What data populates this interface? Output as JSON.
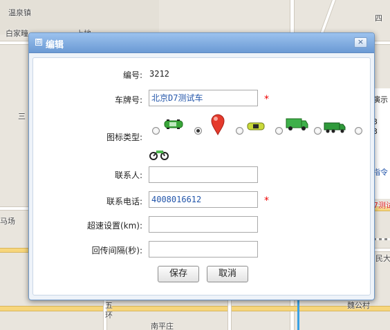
{
  "map": {
    "labels": [
      "温泉镇",
      "白家疃",
      "上地",
      "四",
      "三",
      "马场",
      "五",
      "环",
      "南平庄",
      "魏公村",
      "民大",
      "指令",
      "演示",
      "7测试"
    ],
    "side_panel": [
      "演示",
      "3",
      "3",
      "指令"
    ]
  },
  "dialog": {
    "title": "编辑",
    "close": "×",
    "fields": {
      "number": {
        "label": "编号:",
        "value": "3212"
      },
      "plate": {
        "label": "车牌号:",
        "value": "北京D7测试车",
        "required": "*"
      },
      "icon_type": {
        "label": "图标类型:",
        "selected_index": 1,
        "options": [
          "green-car-icon",
          "red-location-pin-icon",
          "yellow-car-icon",
          "green-van-icon",
          "green-truck-icon",
          "motorcycle-icon"
        ]
      },
      "contact": {
        "label": "联系人:",
        "value": ""
      },
      "phone": {
        "label": "联系电话:",
        "value": "4008016612",
        "required": "*"
      },
      "speed": {
        "label": "超速设置(km):",
        "value": ""
      },
      "interval": {
        "label": "回传间隔(秒):",
        "value": ""
      }
    },
    "buttons": {
      "save": "保存",
      "cancel": "取消"
    }
  },
  "colors": {
    "title_bar": "#6b9ad4",
    "required": "#e00000",
    "field_text": "#2255aa"
  }
}
